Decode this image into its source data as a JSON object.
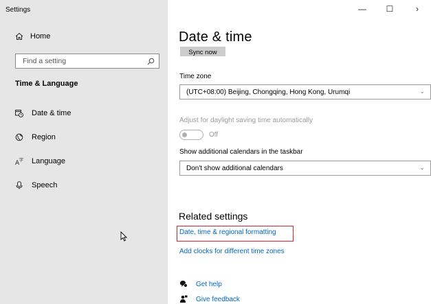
{
  "window": {
    "app_title": "Settings",
    "controls": {
      "minimize": "—",
      "maximize": "☐",
      "close": "›"
    }
  },
  "sidebar": {
    "home_label": "Home",
    "search_placeholder": "Find a setting",
    "section_title": "Time & Language",
    "items": [
      {
        "label": "Date & time",
        "icon": "calendar-clock-icon"
      },
      {
        "label": "Region",
        "icon": "globe-icon"
      },
      {
        "label": "Language",
        "icon": "language-icon"
      },
      {
        "label": "Speech",
        "icon": "microphone-icon"
      }
    ]
  },
  "main": {
    "title": "Date & time",
    "sync_button": "Sync now",
    "time_zone_label": "Time zone",
    "time_zone_value": "(UTC+08:00) Beijing, Chongqing, Hong Kong, Urumqi",
    "dst_label": "Adjust for daylight saving time automatically",
    "dst_toggle_label": "Off",
    "calendars_label": "Show additional calendars in the taskbar",
    "calendars_value": "Don't show additional calendars",
    "related_title": "Related settings",
    "related_links": [
      "Date, time & regional formatting",
      "Add clocks for different time zones"
    ],
    "help": {
      "get_help": "Get help",
      "give_feedback": "Give feedback"
    }
  },
  "colors": {
    "sidebar_bg": "#e6e6e6",
    "link": "#0067c0",
    "highlight": "#d9232b"
  }
}
